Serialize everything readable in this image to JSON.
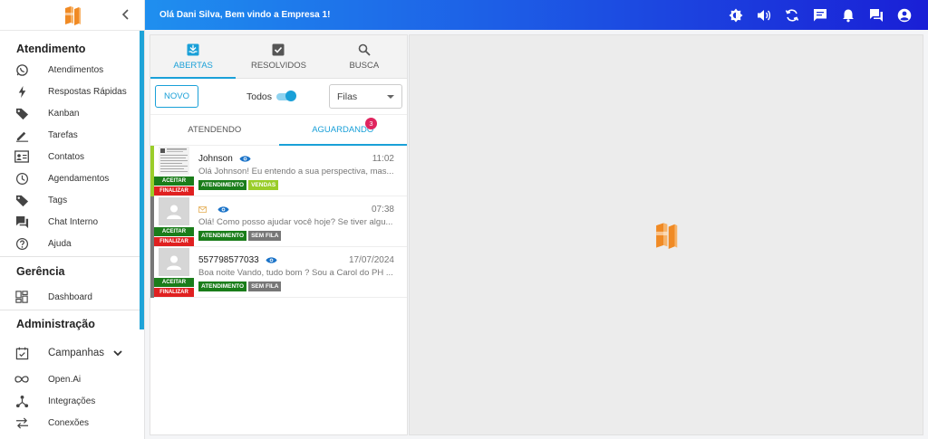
{
  "colors": {
    "accent": "#1aa0d8",
    "accept": "#1a7d1a",
    "finish": "#e02020",
    "tag_green": "#1a7d1a",
    "tag_lime": "#9acd2a",
    "tag_gray": "#777777",
    "badge": "#e0245e"
  },
  "sidebar": {
    "sections": [
      {
        "title": "Atendimento",
        "items": [
          {
            "label": "Atendimentos",
            "icon": "whatsapp-icon"
          },
          {
            "label": "Respostas Rápidas",
            "icon": "bolt-icon"
          },
          {
            "label": "Kanban",
            "icon": "tag-icon"
          },
          {
            "label": "Tarefas",
            "icon": "pencil-icon"
          },
          {
            "label": "Contatos",
            "icon": "contact-card-icon"
          },
          {
            "label": "Agendamentos",
            "icon": "clock-icon"
          },
          {
            "label": "Tags",
            "icon": "tag-icon"
          },
          {
            "label": "Chat Interno",
            "icon": "chat-icon"
          },
          {
            "label": "Ajuda",
            "icon": "help-icon"
          }
        ]
      },
      {
        "title": "Gerência",
        "items": [
          {
            "label": "Dashboard",
            "icon": "dashboard-icon"
          }
        ]
      },
      {
        "title": "Administração",
        "items": [
          {
            "label": "Campanhas",
            "icon": "calendar-check-icon"
          },
          {
            "label": "Open.Ai",
            "icon": "infinity-icon"
          },
          {
            "label": "Integrações",
            "icon": "hub-icon"
          },
          {
            "label": "Conexões",
            "icon": "swap-icon"
          }
        ]
      }
    ]
  },
  "header": {
    "welcome": "Olá Dani Silva, Bem vindo a Empresa 1!",
    "icons": [
      "brightness-icon",
      "volume-icon",
      "refresh-icon",
      "announcement-icon",
      "bell-icon",
      "forum-icon",
      "account-icon"
    ]
  },
  "tabs": [
    {
      "label": "ABERTAS",
      "icon": "inbox-icon",
      "active": true
    },
    {
      "label": "RESOLVIDOS",
      "icon": "check-box-icon",
      "active": false
    },
    {
      "label": "BUSCA",
      "icon": "search-icon",
      "active": false
    }
  ],
  "controls": {
    "novo_label": "NOVO",
    "todos_label": "Todos",
    "todos_on": true,
    "filas_label": "Filas"
  },
  "subtabs": [
    {
      "label": "ATENDENDO",
      "active": false
    },
    {
      "label": "AGUARDANDO",
      "active": true,
      "badge": "3"
    }
  ],
  "tickets": [
    {
      "name": "Johnson",
      "time": "11:02",
      "message": "Olá Johnson! Eu entendo a sua perspectiva, mas...",
      "bar_color": "#9acd2a",
      "avatar": "document-thumbnail",
      "accept_label": "ACEITAR",
      "finish_label": "FINALIZAR",
      "tags": [
        {
          "label": "ATENDIMENTO",
          "color": "#1a7d1a"
        },
        {
          "label": "VENDAS",
          "color": "#9acd2a"
        }
      ]
    },
    {
      "name": "",
      "time": "07:38",
      "message": "Olá! Como posso ajudar você hoje? Se tiver algu...",
      "bar_color": "#777777",
      "avatar": "user-icon",
      "accept_label": "ACEITAR",
      "finish_label": "FINALIZAR",
      "tags": [
        {
          "label": "ATENDIMENTO",
          "color": "#1a7d1a"
        },
        {
          "label": "SEM FILA",
          "color": "#777777"
        }
      ]
    },
    {
      "name": "557798577033",
      "time": "17/07/2024",
      "message": "Boa noite Vando, tudo bom ? Sou a Carol do PH ...",
      "bar_color": "#777777",
      "avatar": "user-icon",
      "accept_label": "ACEITAR",
      "finish_label": "FINALIZAR",
      "tags": [
        {
          "label": "ATENDIMENTO",
          "color": "#1a7d1a"
        },
        {
          "label": "SEM FILA",
          "color": "#777777"
        }
      ]
    }
  ]
}
